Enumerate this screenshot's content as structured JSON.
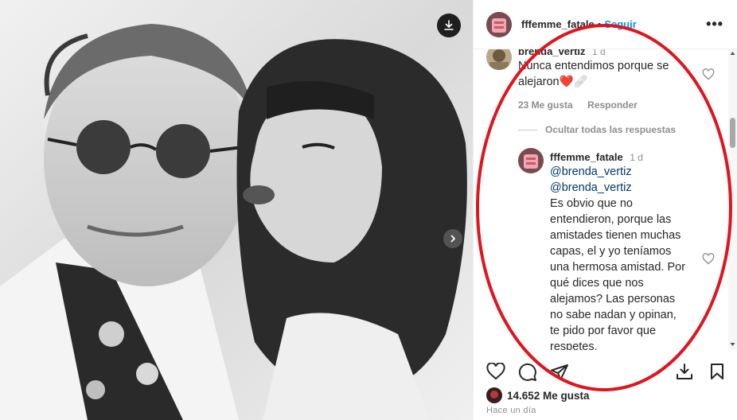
{
  "header": {
    "username": "fffemme_fatale",
    "separator": "•",
    "follow_label": "Seguir",
    "more_label": "•••"
  },
  "comments": {
    "parent": {
      "user": "brenda_vertiz",
      "time": "1 d",
      "text_line1": "Nunca entendimos porque se",
      "text_line2": "alejaron",
      "emoji": "❤️🩹",
      "likes": "23 Me gusta",
      "reply_label": "Responder"
    },
    "hide_replies_label": "Ocultar todas las respuestas",
    "reply": {
      "user": "fffemme_fatale",
      "time": "1 d",
      "mention1": "@brenda_vertiz",
      "mention2": "@brenda_vertiz",
      "lines": [
        "Es obvio que no",
        "entendieron, porque las",
        "amistades tienen muchas",
        "capas, el y yo teníamos",
        "una hermosa amistad. Por",
        "qué dices que nos",
        "alejamos? Las personas",
        "no sabe nadan y opinan,",
        "te pido por favor que",
        "respetes."
      ]
    }
  },
  "post": {
    "likes_count": "14.652 Me gusta",
    "time_ago": "Hace un día"
  },
  "colors": {
    "accent": "#0095f6",
    "annotation": "#e0141e",
    "muted": "#8e8e8e"
  }
}
